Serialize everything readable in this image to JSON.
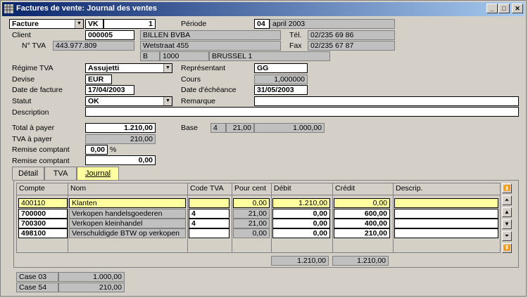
{
  "window": {
    "title": "Factures de vente: Journal des ventes"
  },
  "header": {
    "doc_type": "Facture",
    "journal": "VK",
    "number": "1",
    "periode_label": "Période",
    "periode_num": "04",
    "periode_text": "april 2003"
  },
  "client": {
    "label": "Client",
    "code": "000005",
    "name": "BILLEN BVBA",
    "tva_label": "N° TVA",
    "tva": "443.977.809",
    "street": "Wetstraat 455",
    "country": "B",
    "zip": "1000",
    "city": "BRUSSEL 1",
    "tel_label": "Tél.",
    "tel": "02/235 69 86",
    "fax_label": "Fax",
    "fax": "02/235 67 87"
  },
  "details": {
    "regime_label": "Régime TVA",
    "regime": "Assujetti",
    "representant_label": "Représentant",
    "representant": "GG",
    "devise_label": "Devise",
    "devise": "EUR",
    "cours_label": "Cours",
    "cours": "1,000000",
    "date_facture_label": "Date de facture",
    "date_facture": "17/04/2003",
    "date_echeance_label": "Date d'échéance",
    "date_echeance": "31/05/2003",
    "statut_label": "Statut",
    "statut": "OK",
    "remarque_label": "Remarque",
    "remarque": "",
    "description_label": "Description",
    "description": ""
  },
  "totals": {
    "total_label": "Total à payer",
    "total": "1.210,00",
    "tva_label": "TVA à payer",
    "tva": "210,00",
    "remise_pct_label": "Remise comptant",
    "remise_pct": "0,00",
    "pct_sign": "%",
    "remise_amt_label": "Remise comptant",
    "remise_amt": "0,00",
    "base_label": "Base",
    "base_code": "4",
    "base_rate": "21,00",
    "base_amount": "1.000,00"
  },
  "tabs": [
    {
      "label": "Détail"
    },
    {
      "label": "TVA"
    },
    {
      "label": "Journal"
    }
  ],
  "journal": {
    "columns": [
      "Compte",
      "Nom",
      "Code TVA",
      "Pour cent",
      "Débit",
      "Crédit",
      "Descrip."
    ],
    "rows": [
      {
        "compte": "400110",
        "nom": "Klanten",
        "code": "",
        "pct": "0,00",
        "debit": "1.210,00",
        "credit": "0,00",
        "desc": ""
      },
      {
        "compte": "700000",
        "nom": "Verkopen handelsgoederen",
        "code": "4",
        "pct": "21,00",
        "debit": "0,00",
        "credit": "600,00",
        "desc": ""
      },
      {
        "compte": "700300",
        "nom": "Verkopen kleinhandel",
        "code": "4",
        "pct": "21,00",
        "debit": "0,00",
        "credit": "400,00",
        "desc": ""
      },
      {
        "compte": "498100",
        "nom": "Verschuldigde BTW op verkopen",
        "code": "",
        "pct": "0,00",
        "debit": "0,00",
        "credit": "210,00",
        "desc": ""
      }
    ],
    "total_debit": "1.210,00",
    "total_credit": "1.210,00"
  },
  "cases": [
    {
      "label": "Case 03",
      "value": "1.000,00"
    },
    {
      "label": "Case 54",
      "value": "210,00"
    }
  ]
}
